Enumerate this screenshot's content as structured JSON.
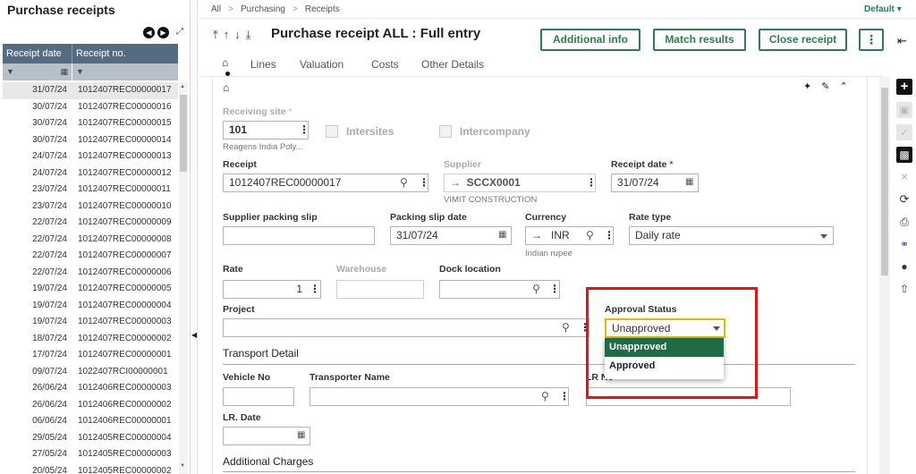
{
  "left_panel": {
    "title": "Purchase receipts",
    "columns": [
      "Receipt date",
      "Receipt no."
    ],
    "rows": [
      {
        "date": "31/07/24",
        "no": "1012407REC00000017"
      },
      {
        "date": "30/07/24",
        "no": "1012407REC00000016"
      },
      {
        "date": "30/07/24",
        "no": "1012407REC00000015"
      },
      {
        "date": "30/07/24",
        "no": "1012407REC00000014"
      },
      {
        "date": "24/07/24",
        "no": "1012407REC00000013"
      },
      {
        "date": "24/07/24",
        "no": "1012407REC00000012"
      },
      {
        "date": "23/07/24",
        "no": "1012407REC00000011"
      },
      {
        "date": "23/07/24",
        "no": "1012407REC00000010"
      },
      {
        "date": "22/07/24",
        "no": "1012407REC00000009"
      },
      {
        "date": "22/07/24",
        "no": "1012407REC00000008"
      },
      {
        "date": "22/07/24",
        "no": "1012407REC00000007"
      },
      {
        "date": "22/07/24",
        "no": "1012407REC00000006"
      },
      {
        "date": "19/07/24",
        "no": "1012407REC00000005"
      },
      {
        "date": "19/07/24",
        "no": "1012407REC00000004"
      },
      {
        "date": "19/07/24",
        "no": "1012407REC00000003"
      },
      {
        "date": "18/07/24",
        "no": "1012407REC00000002"
      },
      {
        "date": "17/07/24",
        "no": "1012407REC00000001"
      },
      {
        "date": "09/07/24",
        "no": "1022407RCI00000001"
      },
      {
        "date": "26/06/24",
        "no": "1012406REC00000003"
      },
      {
        "date": "26/06/24",
        "no": "1012406REC00000002"
      },
      {
        "date": "06/06/24",
        "no": "1012406REC00000001"
      },
      {
        "date": "29/05/24",
        "no": "1012405REC00000004"
      },
      {
        "date": "27/05/24",
        "no": "1012405REC00000003"
      },
      {
        "date": "20/05/24",
        "no": "1012405REC00000002"
      }
    ]
  },
  "breadcrumb": [
    "All",
    "Purchasing",
    "Receipts"
  ],
  "default_label": "Default",
  "header": {
    "title": "Purchase receipt ALL : Full entry",
    "buttons": {
      "additional": "Additional info",
      "match": "Match results",
      "close": "Close receipt"
    }
  },
  "tabs": [
    "Lines",
    "Valuation",
    "Costs",
    "Other Details"
  ],
  "form": {
    "receiving_site": {
      "label": "Receiving site",
      "value": "101",
      "sub": "Reagens India Poly..."
    },
    "intersites": "Intersites",
    "intercompany": "Intercompany",
    "receipt": {
      "label": "Receipt",
      "value": "1012407REC00000017"
    },
    "supplier": {
      "label": "Supplier",
      "value": "SCCX0001",
      "sub": "VIMIT CONSTRUCTION"
    },
    "receipt_date": {
      "label": "Receipt date",
      "value": "31/07/24"
    },
    "supplier_packing_slip": {
      "label": "Supplier packing slip",
      "value": ""
    },
    "packing_slip_date": {
      "label": "Packing slip date",
      "value": "31/07/24"
    },
    "currency": {
      "label": "Currency",
      "value": "INR",
      "sub": "Indian rupee"
    },
    "rate_type": {
      "label": "Rate type",
      "value": "Daily rate"
    },
    "rate": {
      "label": "Rate",
      "value": "1"
    },
    "warehouse": {
      "label": "Warehouse",
      "value": ""
    },
    "dock_location": {
      "label": "Dock location",
      "value": ""
    },
    "project": {
      "label": "Project",
      "value": ""
    },
    "approval_status": {
      "label": "Approval Status",
      "value": "Unapproved",
      "options": [
        "Unapproved",
        "Approved"
      ]
    },
    "transport_section": "Transport Detail",
    "vehicle_no": {
      "label": "Vehicle No",
      "value": ""
    },
    "transporter_name": {
      "label": "Transporter Name",
      "value": ""
    },
    "lr_no": {
      "label": "LR No",
      "visible_fragment": "LR No"
    },
    "lr_date": {
      "label": "LR. Date",
      "value": ""
    },
    "charges_section": "Additional Charges"
  },
  "colors": {
    "brand_green": "#2e7d4f",
    "highlight_red": "#e11111",
    "selected_option": "#1f6b45"
  }
}
